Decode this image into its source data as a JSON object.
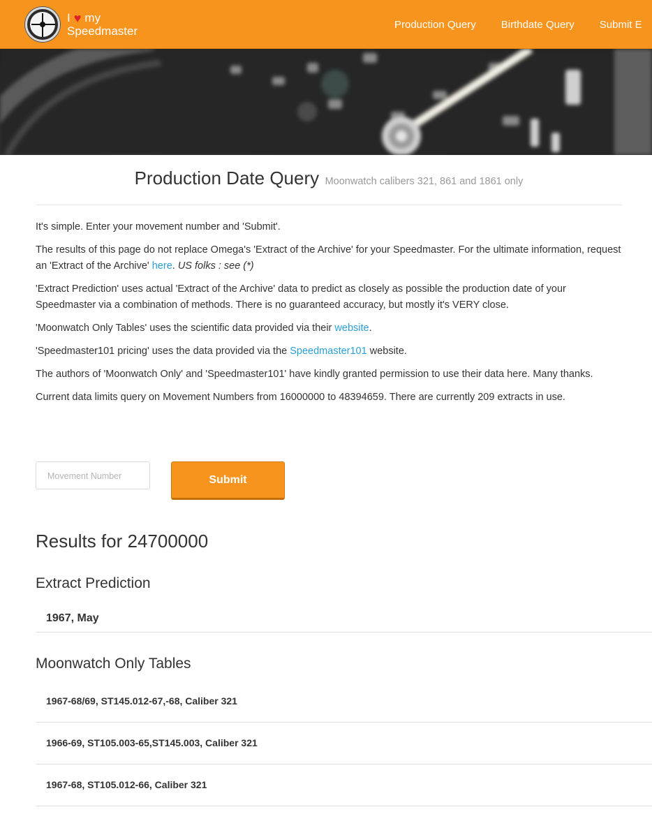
{
  "navbar": {
    "brand_prefix": "I",
    "brand_heart": "♥",
    "brand_suffix": "my",
    "brand_name": "Speedmaster",
    "links": [
      "Production Query",
      "Birthdate Query",
      "Submit E"
    ],
    "color": "#f7941d"
  },
  "header": {
    "title": "Production Date Query",
    "subtitle": "Moonwatch calibers 321, 861 and 1861 only"
  },
  "intro": {
    "p1": "It's simple. Enter your movement number and 'Submit'.",
    "p2_a": "The results of this page do not replace Omega's 'Extract of the Archive' for your Speedmaster. For the ultimate information, request an 'Extract of the Archive' ",
    "p2_link": "here",
    "p2_b": ". ",
    "p2_em": "US folks : see (*)",
    "p3": "'Extract Prediction' uses actual 'Extract of the Archive' data to predict as closely as possible the production date of your Speedmaster via a combination of methods. There is no guaranteed accuracy, but mostly it's VERY close.",
    "p4_a": "'Moonwatch Only Tables' uses the scientific data provided via their ",
    "p4_link": "website",
    "p4_b": ".",
    "p5_a": "'Speedmaster101 pricing' uses the data provided via the ",
    "p5_link": "Speedmaster101",
    "p5_b": " website.",
    "p6": "The authors of 'Moonwatch Only' and 'Speedmaster101' have kindly granted permission to use their data here. Many thanks.",
    "p7": "Current data limits query on Movement Numbers from 16000000 to 48394659. There are currently 209 extracts in use."
  },
  "form": {
    "placeholder": "Movement Number",
    "submit_label": "Submit"
  },
  "results": {
    "title": "Results for 24700000",
    "extract_title": "Extract Prediction",
    "extract_value": "1967, May",
    "moonwatch_title": "Moonwatch Only Tables",
    "moonwatch_rows": [
      "1967-68/69, ST145.012-67,-68, Caliber 321",
      "1966-69, ST105.003-65,ST145.003, Caliber 321",
      "1967-68, ST105.012-66, Caliber 321"
    ]
  }
}
